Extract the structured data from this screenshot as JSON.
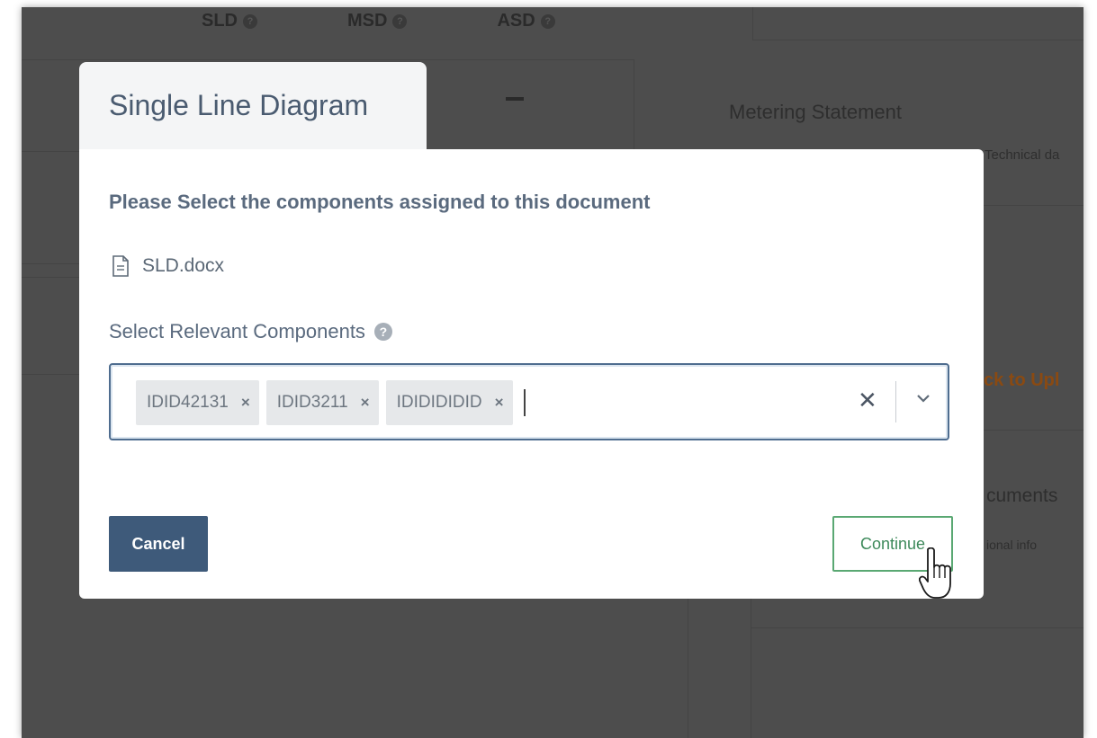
{
  "background": {
    "tabs": [
      "SLD",
      "MSD",
      "ASD"
    ],
    "metering_title": "Metering Statement",
    "metering_sub_left": "",
    "metering_sub_right": "Technical da",
    "orange_link": "ck to Upl",
    "documents_heading": "cuments",
    "documents_sub": "ional info"
  },
  "modal": {
    "title": "Single Line Diagram",
    "instruction": "Please Select the components assigned to this document",
    "file_name": "SLD.docx",
    "field_label": "Select Relevant Components",
    "help_glyph": "?",
    "selected_components": [
      "IDID42131",
      "IDID3211",
      "IDIDIDIDID"
    ],
    "chip_remove_glyph": "×",
    "clear_all_glyph": "✕",
    "cancel_label": "Cancel",
    "continue_label": "Continue"
  },
  "colors": {
    "overlay": "#4d4d4d",
    "title_text": "#4a5b70",
    "cancel_bg": "#3e5a7a",
    "continue_border": "#5aa873",
    "continue_text": "#3e8a5b",
    "select_border": "#4f6d8f",
    "orange_link": "#8a4a12"
  }
}
